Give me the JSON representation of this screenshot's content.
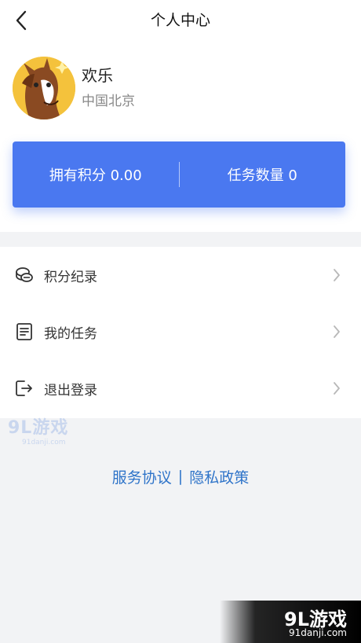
{
  "header": {
    "title": "个人中心",
    "back_icon": "chevron-left-icon"
  },
  "profile": {
    "name": "欢乐",
    "location": "中国北京",
    "avatar_icon": "horse-avatar"
  },
  "stats": {
    "points_label": "拥有积分 0.00",
    "tasks_label": "任务数量 0",
    "card_color": "#4a78f0"
  },
  "menu": {
    "items": [
      {
        "label": "积分纪录",
        "icon": "coins-icon"
      },
      {
        "label": "我的任务",
        "icon": "document-icon"
      },
      {
        "label": "退出登录",
        "icon": "logout-icon"
      }
    ]
  },
  "footer": {
    "service_agreement": "服务协议",
    "separator": "|",
    "privacy_policy": "隐私政策",
    "link_color": "#2f74c9"
  },
  "watermark": {
    "brand": "9L游戏",
    "site": "91danji.com",
    "site_bottom": "91danji.com"
  }
}
